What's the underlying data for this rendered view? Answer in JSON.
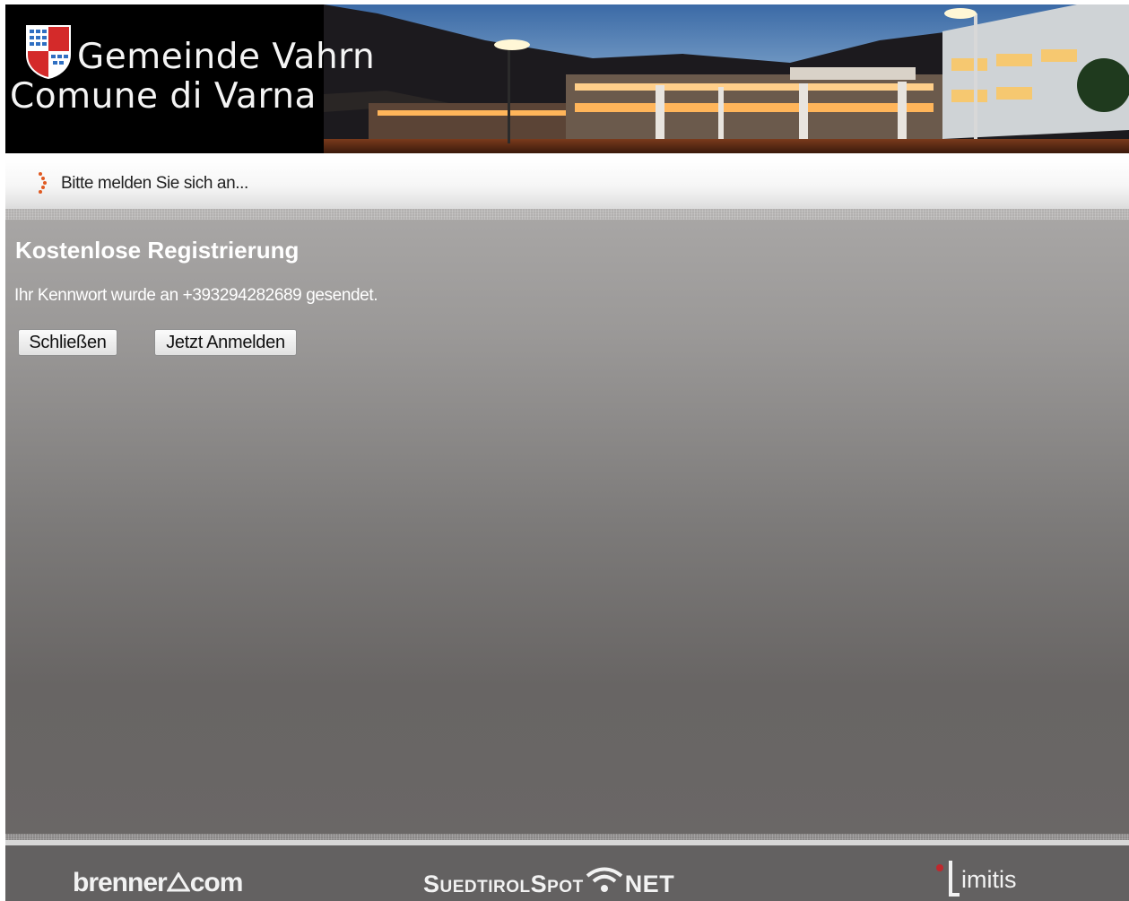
{
  "header": {
    "title_de": "Gemeinde Vahrn",
    "title_it": "Comune di Varna"
  },
  "hint_bar": {
    "text": "Bitte melden Sie sich an..."
  },
  "panel": {
    "title": "Kostenlose Registrierung",
    "message": "Ihr Kennwort wurde an +393294282689 gesendet.",
    "buttons": {
      "close_label": "Schließen",
      "login_label": "Jetzt Anmelden"
    }
  },
  "footer": {
    "logos": {
      "brenner": "brenner",
      "brenner_suffix": "com",
      "suedtirolspot": "SuedtirolSpot",
      "suedtirolspot_suffix": "NET",
      "limitis": "imitis"
    }
  },
  "colors": {
    "accent": "#e05a22",
    "panel_top": "#a9a7a6",
    "panel_bottom": "#686564",
    "footer_bg": "#636161"
  }
}
